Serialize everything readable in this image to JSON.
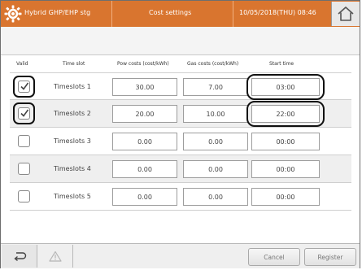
{
  "header": {
    "brand": "Hybrid GHP/EHP stg",
    "title": "Cost settings",
    "datetime": "10/05/2018(THU) 08:46",
    "home_icon": "home-icon",
    "logo_icon": "gear-logo-icon"
  },
  "table": {
    "columns": [
      "Valid",
      "Time slot",
      "Pow costs (cost/kWh)",
      "Gas costs (cost/kWh)",
      "Start time"
    ],
    "rows": [
      {
        "valid": true,
        "slot": "Timeslots 1",
        "pow": "30.00",
        "gas": "7.00",
        "start": "03:00",
        "highlighted": true
      },
      {
        "valid": true,
        "slot": "Timeslots 2",
        "pow": "20.00",
        "gas": "10.00",
        "start": "22:00",
        "highlighted": true
      },
      {
        "valid": false,
        "slot": "Timeslots 3",
        "pow": "0.00",
        "gas": "0.00",
        "start": "00:00",
        "highlighted": false
      },
      {
        "valid": false,
        "slot": "Timeslots 4",
        "pow": "0.00",
        "gas": "0.00",
        "start": "00:00",
        "highlighted": false
      },
      {
        "valid": false,
        "slot": "Timeslots 5",
        "pow": "0.00",
        "gas": "0.00",
        "start": "00:00",
        "highlighted": false
      }
    ]
  },
  "footer": {
    "back_icon": "back-arrow-icon",
    "warning_icon": "warning-icon",
    "cancel_label": "Cancel",
    "register_label": "Register"
  },
  "colors": {
    "topbar": "#d9752f",
    "highlight_ring": "#111111"
  }
}
